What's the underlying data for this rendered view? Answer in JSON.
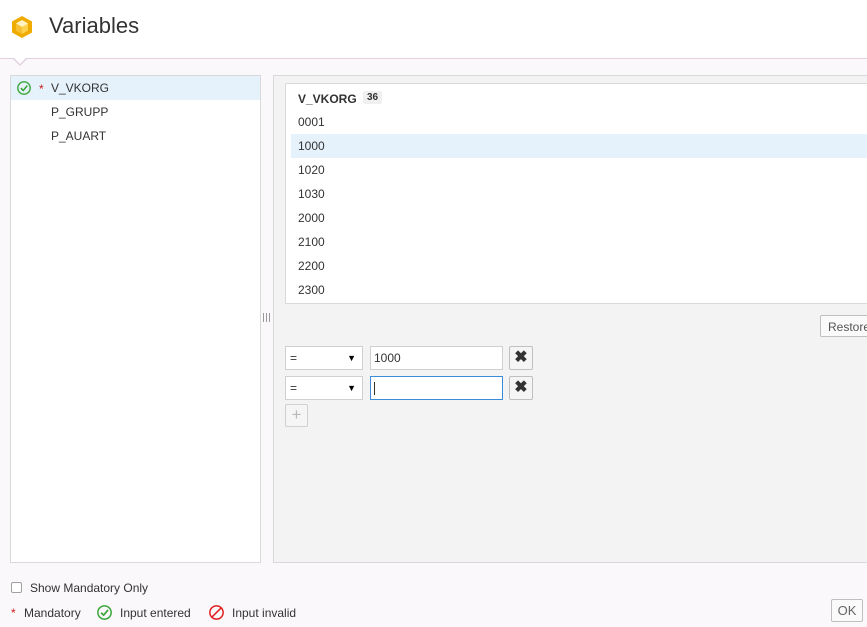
{
  "header": {
    "title": "Variables"
  },
  "variables": {
    "items": [
      {
        "label": "V_VKORG",
        "mandatory_mark": "*",
        "status_icon": "check-circle-icon",
        "selected": true
      },
      {
        "label": "P_GRUPP"
      },
      {
        "label": "P_AUART"
      }
    ]
  },
  "values_list": {
    "header": "V_VKORG",
    "count": "36",
    "items": [
      "0001",
      "1000",
      "1020",
      "1030",
      "2000",
      "2100",
      "2200",
      "2300"
    ],
    "selected_item": "1000"
  },
  "restore_label": "Restore",
  "filters": [
    {
      "operator": "=",
      "value": "",
      "display": "1000"
    },
    {
      "operator": "=",
      "value": ""
    }
  ],
  "add_label": "+",
  "footer": {
    "show_mandatory_label": "Show Mandatory Only",
    "legend": {
      "mandatory_mark": "*",
      "mandatory": "Mandatory",
      "input_entered": "Input entered",
      "input_invalid": "Input invalid"
    },
    "ok_label": "OK"
  },
  "colors": {
    "accent": "#3a8dd6",
    "selection": "#e5f1fb",
    "valid": "#3aa63a",
    "invalid": "#e02020",
    "mandatory": "#cc1919",
    "logo": "#f0ab00"
  }
}
